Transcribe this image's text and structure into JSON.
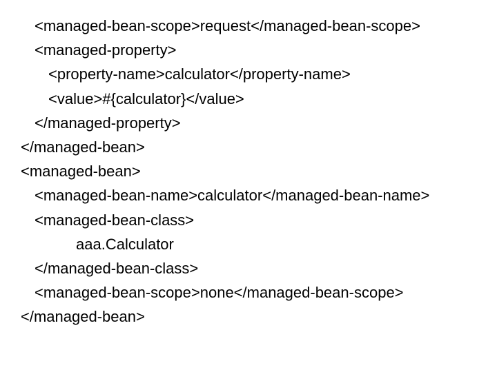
{
  "lines": [
    {
      "cls": "i1",
      "text": "<managed-bean-scope>request</managed-bean-scope>"
    },
    {
      "cls": "i1",
      "text": "<managed-property>"
    },
    {
      "cls": "i2",
      "text": "<property-name>calculator</property-name>"
    },
    {
      "cls": "i2",
      "text": "<value>#{calculator}</value>"
    },
    {
      "cls": "i1",
      "text": "</managed-property>"
    },
    {
      "cls": "",
      "text": "</managed-bean>"
    },
    {
      "cls": "",
      "text": "<managed-bean>"
    },
    {
      "cls": "i1",
      "text": "<managed-bean-name>calculator</managed-bean-name>"
    },
    {
      "cls": "i1",
      "text": "<managed-bean-class>"
    },
    {
      "cls": "i3",
      "text": "aaa.Calculator"
    },
    {
      "cls": "i1",
      "text": "</managed-bean-class>"
    },
    {
      "cls": "i1",
      "text": "<managed-bean-scope>none</managed-bean-scope>"
    },
    {
      "cls": "",
      "text": "</managed-bean>"
    }
  ]
}
